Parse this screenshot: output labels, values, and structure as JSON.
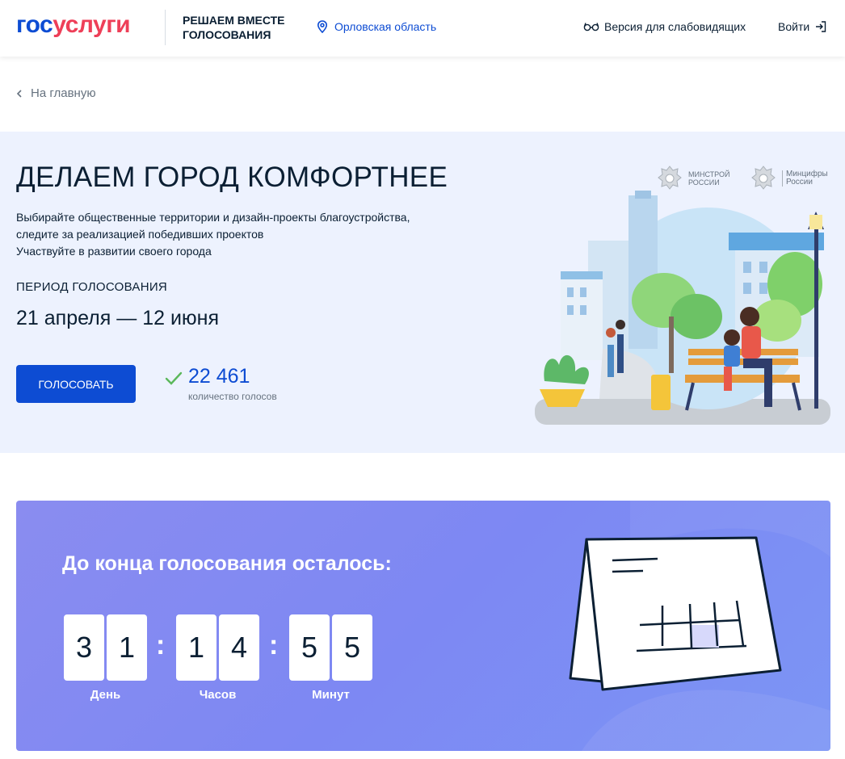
{
  "header": {
    "logo_part1": "гос",
    "logo_part2": "услуги",
    "project_line1": "РЕШАЕМ ВМЕСТЕ",
    "project_line2": "ГОЛОСОВАНИЯ",
    "region": "Орловская область",
    "accessibility": "Версия для слабовидящих",
    "login": "Войти"
  },
  "nav": {
    "back": "На главную"
  },
  "hero": {
    "title": "ДЕЛАЕМ ГОРОД КОМФОРТНЕЕ",
    "desc_line1": "Выбирайте общественные территории и дизайн-проекты благоустройства,",
    "desc_line2": "следите за реализацией победивших проектов",
    "desc_line3": "Участвуйте в развитии своего города",
    "period_label": "ПЕРИОД ГОЛОСОВАНИЯ",
    "period_dates": "21 апреля — 12 июня",
    "vote_button": "ГОЛОСОВАТЬ",
    "vote_count": "22 461",
    "vote_caption": "количество голосов",
    "ministry1_line1": "МИНСТРОЙ",
    "ministry1_line2": "РОССИИ",
    "ministry2_line1": "Минцифры",
    "ministry2_line2": "России"
  },
  "countdown": {
    "title": "До конца голосования осталось:",
    "days": [
      "3",
      "1"
    ],
    "hours": [
      "1",
      "4"
    ],
    "minutes": [
      "5",
      "5"
    ],
    "label_days": "День",
    "label_hours": "Часов",
    "label_minutes": "Минут"
  },
  "colors": {
    "brand_blue": "#0d4cd3",
    "brand_red": "#ee3f58",
    "hero_bg": "#edf2fe",
    "countdown_bg": "#8a8cf0"
  }
}
